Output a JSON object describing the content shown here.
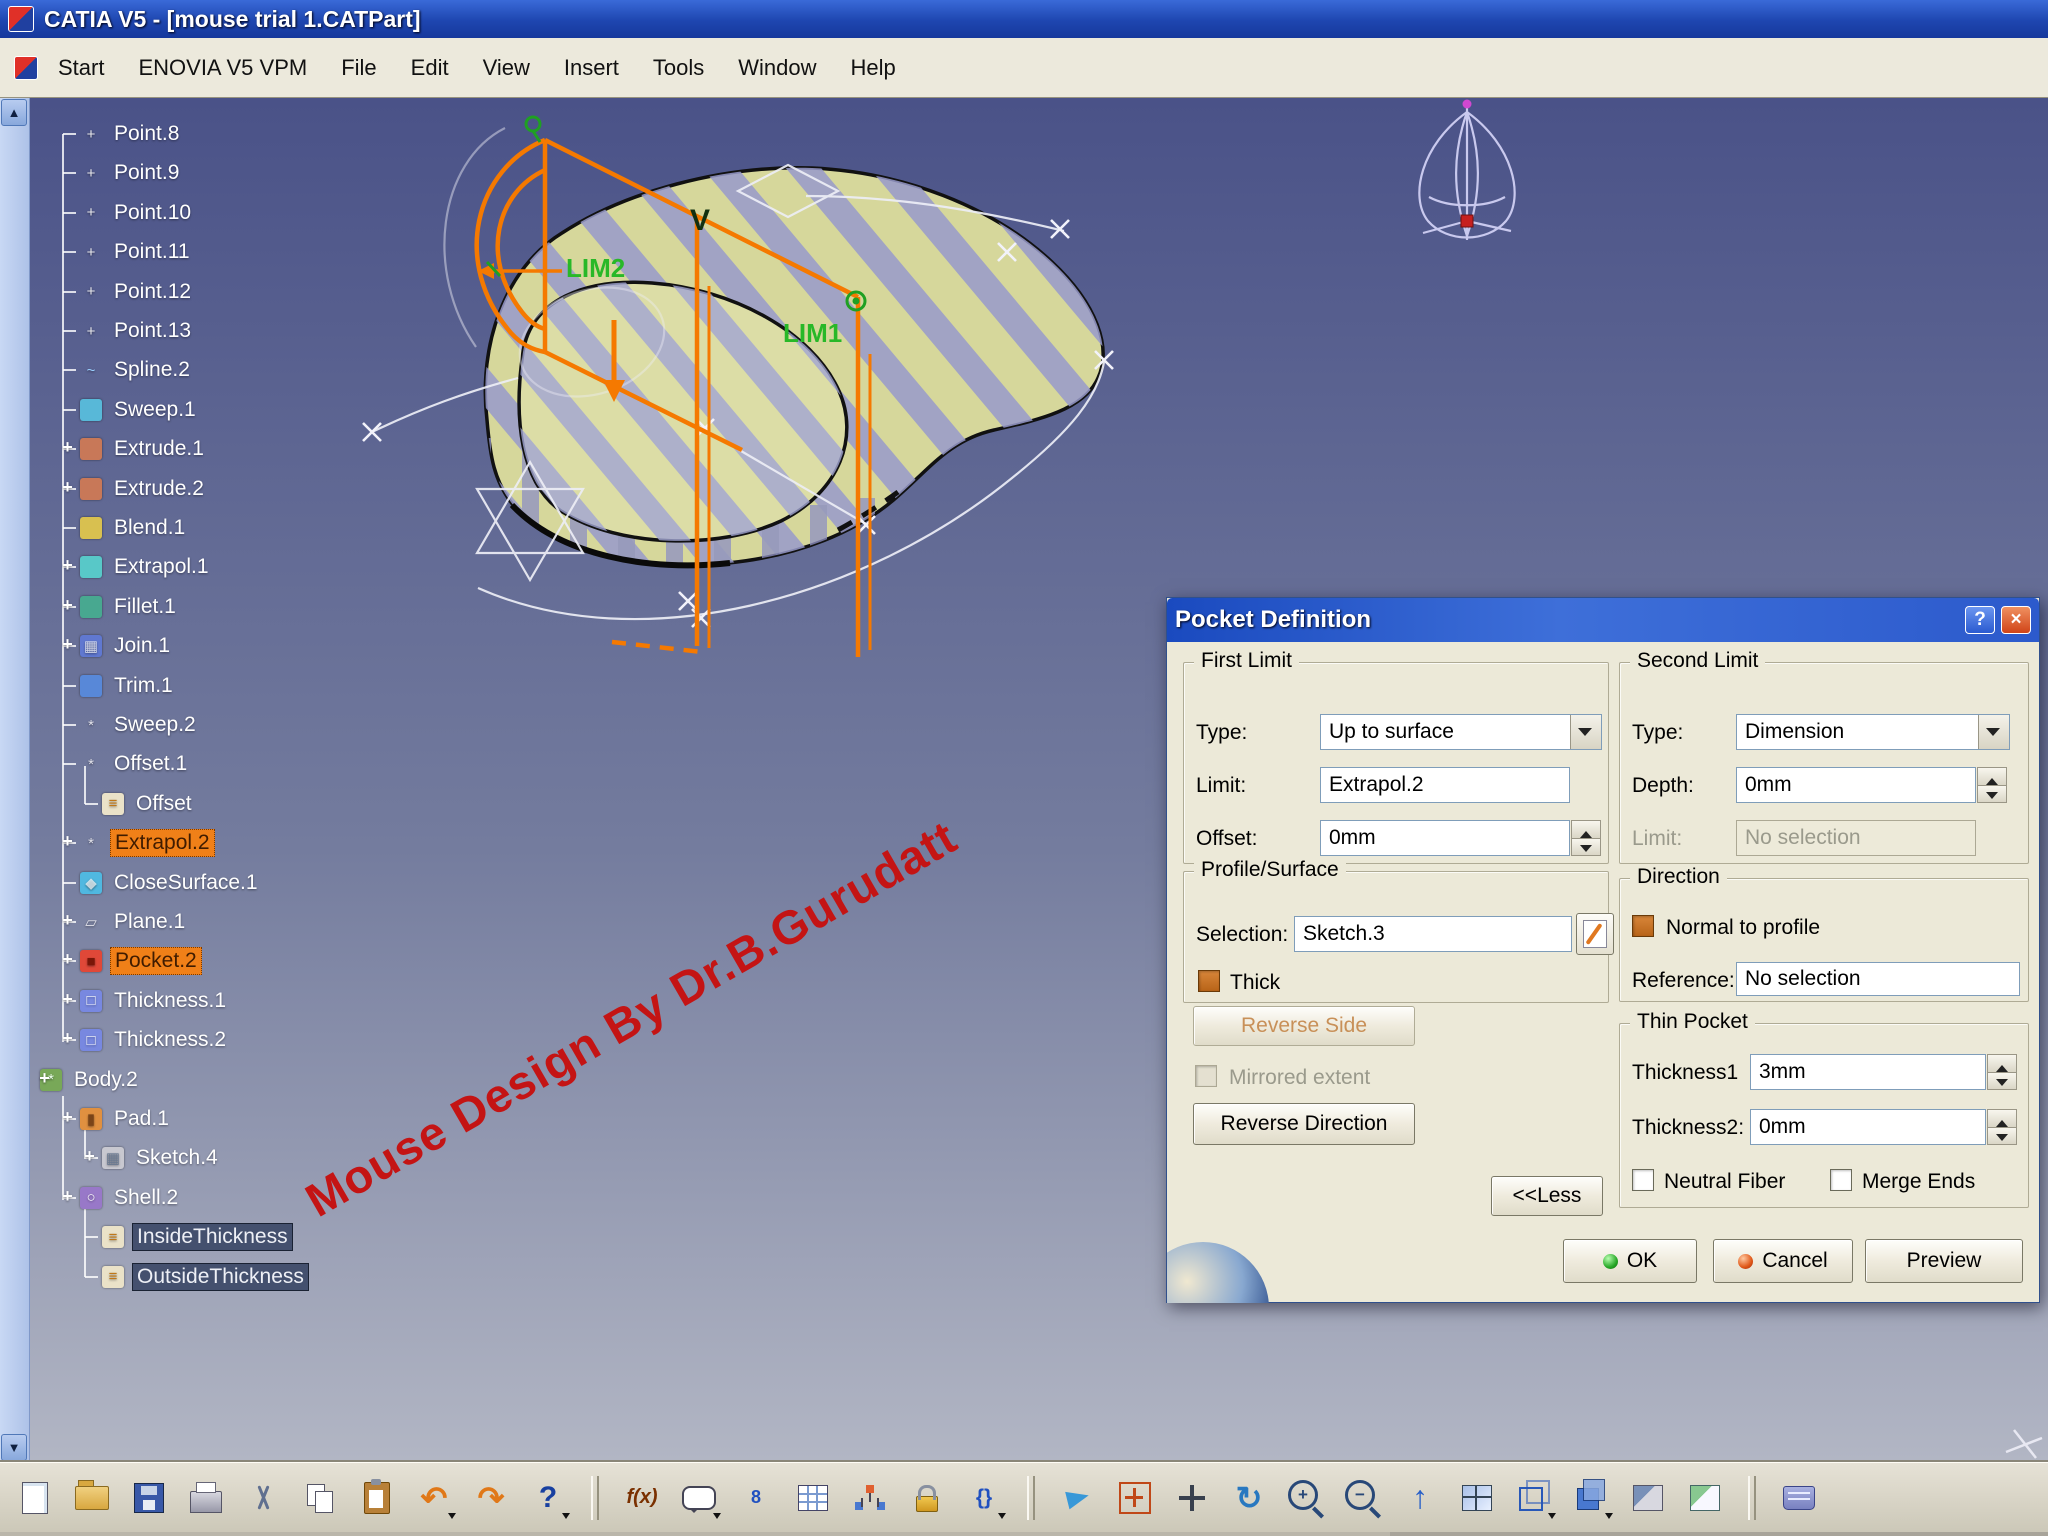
{
  "window": {
    "title": "CATIA V5 - [mouse trial 1.CATPart]"
  },
  "menubar": {
    "items": [
      "Start",
      "ENOVIA V5 VPM",
      "File",
      "Edit",
      "View",
      "Insert",
      "Tools",
      "Window",
      "Help"
    ]
  },
  "tree": {
    "items": [
      {
        "label": "Point.8",
        "icon": "point",
        "indent": 1
      },
      {
        "label": "Point.9",
        "icon": "point",
        "indent": 1
      },
      {
        "label": "Point.10",
        "icon": "point",
        "indent": 1
      },
      {
        "label": "Point.11",
        "icon": "point",
        "indent": 1
      },
      {
        "label": "Point.12",
        "icon": "point",
        "indent": 1
      },
      {
        "label": "Point.13",
        "icon": "point",
        "indent": 1
      },
      {
        "label": "Spline.2",
        "icon": "spline",
        "indent": 1
      },
      {
        "label": "Sweep.1",
        "icon": "sweep",
        "indent": 1
      },
      {
        "label": "Extrude.1",
        "icon": "extrude",
        "indent": 1,
        "plus": true
      },
      {
        "label": "Extrude.2",
        "icon": "extrude",
        "indent": 1,
        "plus": true
      },
      {
        "label": "Blend.1",
        "icon": "blend",
        "indent": 1
      },
      {
        "label": "Extrapol.1",
        "icon": "extrapol",
        "indent": 1,
        "plus": true
      },
      {
        "label": "Fillet.1",
        "icon": "fillet",
        "indent": 1,
        "plus": true
      },
      {
        "label": "Join.1",
        "icon": "join",
        "indent": 1,
        "plus": true
      },
      {
        "label": "Trim.1",
        "icon": "trim",
        "indent": 1
      },
      {
        "label": "Sweep.2",
        "icon": "star",
        "indent": 1
      },
      {
        "label": "Offset.1",
        "icon": "star",
        "indent": 1
      },
      {
        "label": "Offset",
        "icon": "folder",
        "indent": 2
      },
      {
        "label": "Extrapol.2",
        "icon": "star",
        "indent": 1,
        "plus": true,
        "highlight": "orange"
      },
      {
        "label": "CloseSurface.1",
        "icon": "closesurface",
        "indent": 1
      },
      {
        "label": "Plane.1",
        "icon": "plane",
        "indent": 1,
        "plus": true
      },
      {
        "label": "Pocket.2",
        "icon": "pocket",
        "indent": 1,
        "plus": true,
        "highlight": "orange"
      },
      {
        "label": "Thickness.1",
        "icon": "thickness",
        "indent": 1,
        "plus": true
      },
      {
        "label": "Thickness.2",
        "icon": "thickness",
        "indent": 1,
        "plus": true
      },
      {
        "label": "Body.2",
        "icon": "body",
        "indent": 0,
        "plus": true
      },
      {
        "label": "Pad.1",
        "icon": "pad",
        "indent": 1,
        "plus": true
      },
      {
        "label": "Sketch.4",
        "icon": "sketch",
        "indent": 2,
        "plus": true
      },
      {
        "label": "Shell.2",
        "icon": "shell",
        "indent": 1,
        "plus": true
      },
      {
        "label": "InsideThickness",
        "icon": "folder",
        "indent": 2,
        "highlight": "dark"
      },
      {
        "label": "OutsideThickness",
        "icon": "folder",
        "indent": 2,
        "highlight": "dark"
      }
    ]
  },
  "viewport": {
    "watermark": "Mouse Design By Dr.B.Gurudatt",
    "labels": {
      "lim1": "LIM1",
      "lim2": "LIM2",
      "v": "V"
    }
  },
  "dialog": {
    "title": "Pocket Definition",
    "help_button": "?",
    "close_button": "×",
    "first_limit": {
      "legend": "First Limit",
      "type_label": "Type:",
      "type_value": "Up to surface",
      "limit_label": "Limit:",
      "limit_value": "Extrapol.2",
      "offset_label": "Offset:",
      "offset_value": "0mm"
    },
    "second_limit": {
      "legend": "Second Limit",
      "type_label": "Type:",
      "type_value": "Dimension",
      "depth_label": "Depth:",
      "depth_value": "0mm",
      "limit_label": "Limit:",
      "limit_value": "No selection"
    },
    "profile": {
      "legend": "Profile/Surface",
      "selection_label": "Selection:",
      "selection_value": "Sketch.3",
      "thick_label": "Thick"
    },
    "direction": {
      "legend": "Direction",
      "normal_label": "Normal to profile",
      "reference_label": "Reference:",
      "reference_value": "No selection"
    },
    "thin_pocket": {
      "legend": "Thin Pocket",
      "thickness1_label": "Thickness1",
      "thickness1_value": "3mm",
      "thickness2_label": "Thickness2:",
      "thickness2_value": "0mm",
      "neutral_fiber_label": "Neutral Fiber",
      "merge_ends_label": "Merge Ends"
    },
    "buttons": {
      "reverse_side": "Reverse Side",
      "mirrored_extent": "Mirrored extent",
      "reverse_direction": "Reverse Direction",
      "less": "<<Less",
      "ok": "OK",
      "cancel": "Cancel",
      "preview": "Preview"
    }
  },
  "toolbar": {
    "items": [
      {
        "name": "new-document-icon"
      },
      {
        "name": "open-icon"
      },
      {
        "name": "save-icon"
      },
      {
        "name": "print-icon"
      },
      {
        "name": "cut-icon"
      },
      {
        "name": "copy-icon"
      },
      {
        "name": "paste-icon"
      },
      {
        "name": "undo-icon",
        "arrow": true
      },
      {
        "name": "redo-icon"
      },
      {
        "name": "what-is-this-icon",
        "arrow": true
      },
      {
        "name": "separator"
      },
      {
        "name": "formula-icon"
      },
      {
        "name": "annotation-icon",
        "arrow": true
      },
      {
        "name": "catalog-icon"
      },
      {
        "name": "design-table-icon"
      },
      {
        "name": "structure-icon"
      },
      {
        "name": "lock-icon"
      },
      {
        "name": "check-icon",
        "arrow": true
      },
      {
        "name": "separator"
      },
      {
        "name": "fly-icon"
      },
      {
        "name": "pan-frame-icon"
      },
      {
        "name": "pan-icon"
      },
      {
        "name": "rotate-icon"
      },
      {
        "name": "zoom-in-icon"
      },
      {
        "name": "zoom-out-icon"
      },
      {
        "name": "fit-all-icon"
      },
      {
        "name": "split-view-icon"
      },
      {
        "name": "iso-view-icon",
        "arrow": true
      },
      {
        "name": "shaded-view-icon",
        "arrow": true
      },
      {
        "name": "hidden-line-view-icon"
      },
      {
        "name": "render-style-icon"
      },
      {
        "name": "separator"
      },
      {
        "name": "catalog-browser-icon"
      }
    ]
  },
  "colors": {
    "selection_highlight": "#F08018",
    "sketch_orange": "#F57900",
    "construction_green": "#28B828",
    "watermark_red": "#C41414",
    "model_fill": "#D6D79B",
    "model_stripe": "#989BCC"
  }
}
